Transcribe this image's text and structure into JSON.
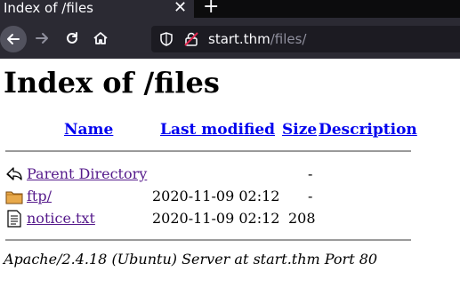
{
  "browser": {
    "tab_title": "Index of /files",
    "tab_close": "✕",
    "new_tab": "+",
    "url_host": "start.thm",
    "url_path": "/files/"
  },
  "page": {
    "heading": "Index of /files",
    "columns": {
      "name": "Name",
      "last_modified": "Last modified",
      "size": "Size",
      "description": "Description"
    },
    "rows": [
      {
        "icon": "back-arrow-icon",
        "name": "Parent Directory",
        "modified": "",
        "size": "-"
      },
      {
        "icon": "folder-icon",
        "name": "ftp/",
        "modified": "2020-11-09 02:12",
        "size": "-"
      },
      {
        "icon": "text-file-icon",
        "name": "notice.txt",
        "modified": "2020-11-09 02:12",
        "size": "208"
      }
    ],
    "footer": "Apache/2.4.18 (Ubuntu) Server at start.thm Port 80"
  },
  "colors": {
    "chrome_bg": "#2b2a33",
    "tabstrip_bg": "#0c0c0d",
    "link_unvisited": "#0000ee",
    "link_visited": "#551a8b"
  }
}
